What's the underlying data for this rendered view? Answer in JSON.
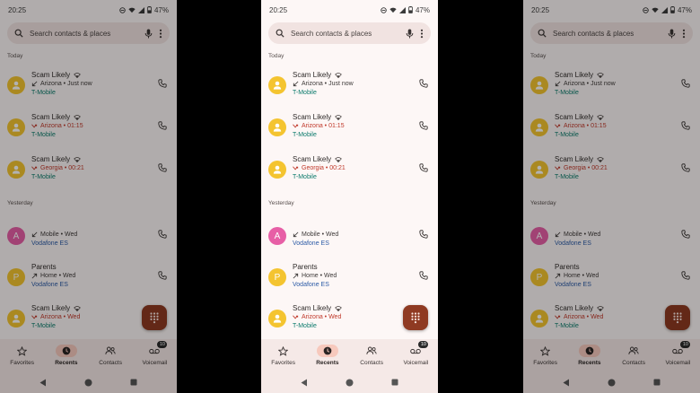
{
  "status": {
    "time": "20:25",
    "battery": "47%"
  },
  "search": {
    "placeholder": "Search contacts & places"
  },
  "sections": {
    "today": "Today",
    "yesterday": "Yesterday"
  },
  "calls": [
    {
      "name": "Scam Likely",
      "wifi": true,
      "type": "incoming",
      "detail": "Arizona • Just now",
      "carrier": "T-Mobile",
      "carrier_style": "tm",
      "avatar_kind": "person",
      "avatar_color": "#f4c430"
    },
    {
      "name": "Scam Likely",
      "wifi": true,
      "type": "missed",
      "detail": "Arizona • 01:15",
      "carrier": "T-Mobile",
      "carrier_style": "tm",
      "avatar_kind": "person",
      "avatar_color": "#f4c430"
    },
    {
      "name": "Scam Likely",
      "wifi": true,
      "type": "missed",
      "detail": "Georgia • 00:21",
      "carrier": "T-Mobile",
      "carrier_style": "tm",
      "avatar_kind": "person",
      "avatar_color": "#f4c430"
    },
    {
      "name": "",
      "wifi": false,
      "type": "incoming",
      "detail": "Mobile • Wed",
      "carrier": "Vodafone ES",
      "carrier_style": "vf",
      "avatar_kind": "letter",
      "avatar_letter": "A",
      "avatar_color": "#e75fa6"
    },
    {
      "name": "Parents",
      "wifi": false,
      "type": "outgoing",
      "detail": "Home • Wed",
      "carrier": "Vodafone ES",
      "carrier_style": "vf",
      "avatar_kind": "letter",
      "avatar_letter": "P",
      "avatar_color": "#f4c430"
    },
    {
      "name": "Scam Likely",
      "wifi": true,
      "type": "missed",
      "detail": "Arizona • Wed",
      "carrier": "T-Mobile",
      "carrier_style": "tm",
      "avatar_kind": "person",
      "avatar_color": "#f4c430"
    }
  ],
  "nav": {
    "favorites": "Favorites",
    "recents": "Recents",
    "contacts": "Contacts",
    "voicemail": "Voicemail",
    "voicemail_badge": "10",
    "active": "recents"
  },
  "colors": {
    "accent": "#8f3a22",
    "missed": "#c0392b",
    "tmobile": "#0a7a6b",
    "vodafone": "#2c5ba6",
    "active_pill": "#f7c9bd"
  },
  "icons": [
    "search-icon",
    "mic-icon",
    "more-vert-icon",
    "phone-icon",
    "dialpad-icon",
    "star-icon",
    "clock-icon",
    "people-icon",
    "voicemail-icon",
    "wifi-icon",
    "back-icon",
    "home-icon",
    "recents-square-icon"
  ]
}
